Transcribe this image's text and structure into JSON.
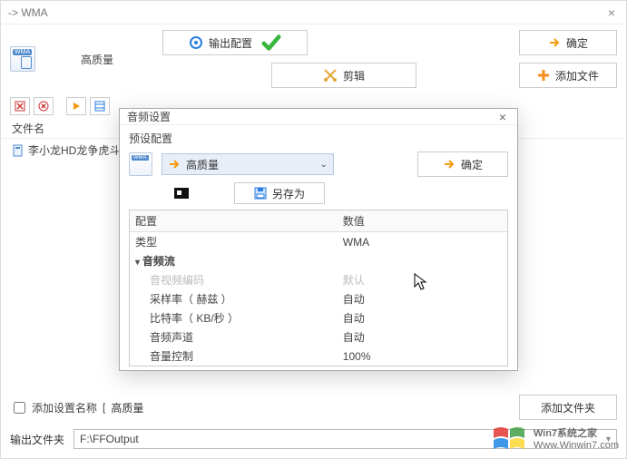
{
  "window": {
    "title": "-> WMA",
    "close_glyph": "×"
  },
  "toprow": {
    "quality_label": "高质量",
    "output_button": "输出配置",
    "ok_button": "确定",
    "add_file_button": "添加文件",
    "edit_button": "剪辑"
  },
  "file_list": {
    "header": "文件名",
    "items": [
      "李小龙HD龙争虎斗.m"
    ]
  },
  "bottom": {
    "add_setting_name_label": "添加设置名称",
    "add_setting_name_value": "高质量",
    "add_folder_button": "添加文件夹",
    "output_folder_label": "输出文件夹",
    "output_folder_value": "F:\\FFOutput"
  },
  "watermark": {
    "line1": "Win7系统之家",
    "line2": "Www.Winwin7.com"
  },
  "modal": {
    "title": "音频设置",
    "preset_label": "预设配置",
    "preset_value": "高质量",
    "ok_button": "确定",
    "save_as_button": "另存为",
    "table": {
      "headers": [
        "配置",
        "数值"
      ],
      "groups": [
        {
          "rows": [
            {
              "k": "类型",
              "v": "WMA",
              "plain": true
            }
          ]
        },
        {
          "section": "音频流",
          "rows": [
            {
              "k": "音视频编码",
              "v": "默认",
              "disabled": true
            },
            {
              "k": "采样率（ 赫兹 ）",
              "v": "自动"
            },
            {
              "k": "比特率（ KB/秒 ）",
              "v": "自动"
            },
            {
              "k": "音频声道",
              "v": "自动"
            },
            {
              "k": "音量控制",
              "v": "100%"
            }
          ]
        }
      ]
    }
  }
}
